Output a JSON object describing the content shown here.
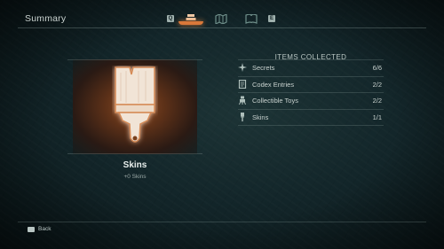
{
  "header": {
    "title": "Summary",
    "prev_key": "Q",
    "next_key": "E",
    "tabs": [
      {
        "icon": "collection-stack-icon",
        "active": true
      },
      {
        "icon": "map-icon",
        "active": false
      },
      {
        "icon": "journal-icon",
        "active": false
      }
    ]
  },
  "selected_item": {
    "icon": "paintbrush-icon",
    "name": "Skins",
    "subtitle": "+0 Skins"
  },
  "collection": {
    "header": "ITEMS COLLECTED",
    "rows": [
      {
        "icon": "secret-sparkle-icon",
        "label": "Secrets",
        "count": "6/6"
      },
      {
        "icon": "codex-book-icon",
        "label": "Codex Entries",
        "count": "2/2"
      },
      {
        "icon": "toy-robot-icon",
        "label": "Collectible Toys",
        "count": "2/2"
      },
      {
        "icon": "paintbrush-icon",
        "label": "Skins",
        "count": "1/1"
      }
    ]
  },
  "footer": {
    "back_label": "Back"
  },
  "colors": {
    "accent": "#d9783a",
    "background": "#13262a",
    "text": "#c9d2cf"
  }
}
